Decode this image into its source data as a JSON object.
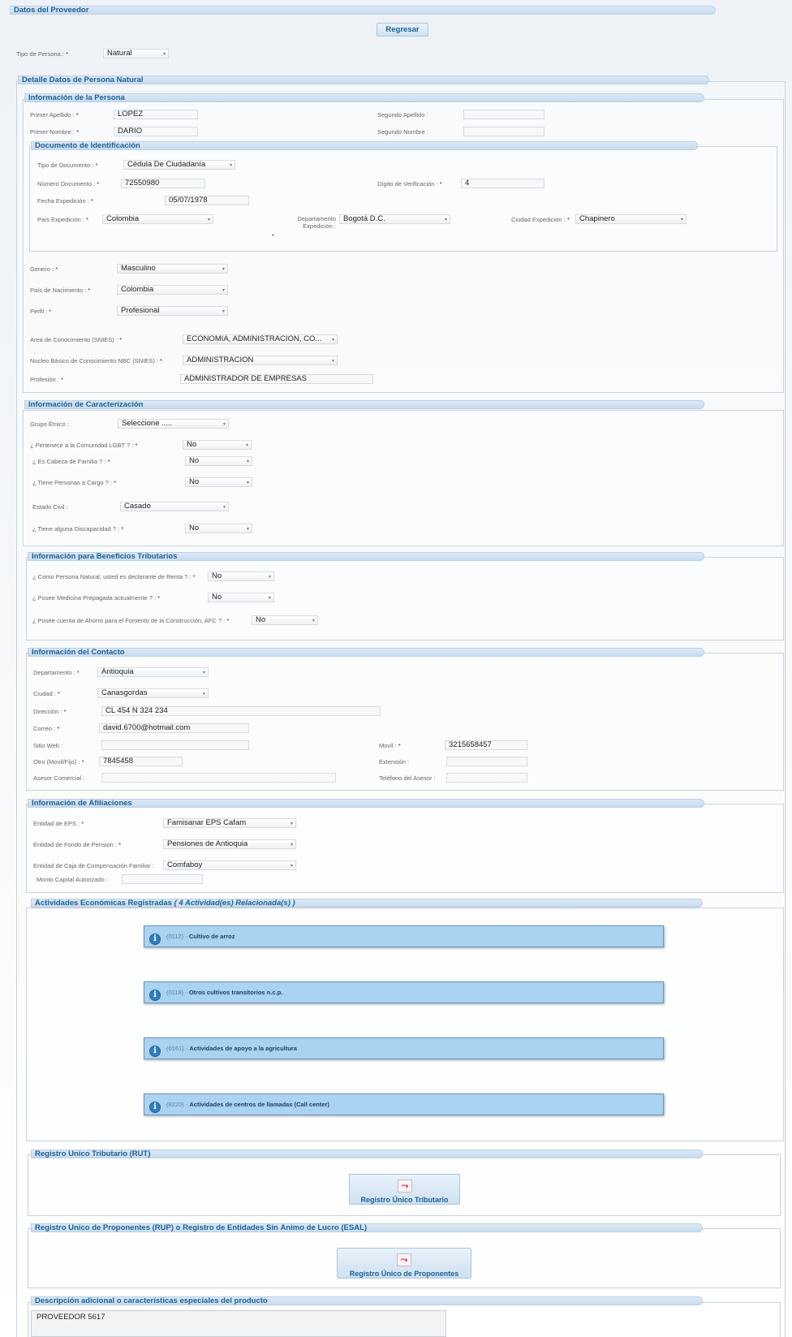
{
  "proveedor": {
    "title": "Datos del Proveedor",
    "regresar": "Regresar",
    "tipo_persona_label": "Tipo de Persona :",
    "tipo_persona_value": "Natural"
  },
  "detalle_title": "Detalle Datos de Persona Natural",
  "persona": {
    "title": "Información de la Persona",
    "primer_apellido_label": "Primer Apellido :",
    "primer_apellido": "LOPEZ",
    "segundo_apellido_label": "Segundo Apellido :",
    "segundo_apellido": "",
    "primer_nombre_label": "Primer Nombre :",
    "primer_nombre": "DARIO",
    "segundo_nombre_label": "Segundo Nombre :",
    "segundo_nombre": ""
  },
  "documento": {
    "title": "Documento de Identificación",
    "tipo_label": "Tipo de Documento :",
    "tipo": "Cédula De Ciudadanía",
    "numero_label": "Número Documento :",
    "numero": "72550980",
    "digito_label": "Dígito de Verificación :",
    "digito": "4",
    "fecha_label": "Fecha Expedición :",
    "fecha": "05/07/1978",
    "pais_label": "País Expedición :",
    "pais": "Colombia",
    "depto_label": "Departamento Expedición :",
    "depto": "Bogotá D.C.",
    "ciudad_label": "Ciudad Expedición :",
    "ciudad": "Chapinero"
  },
  "general": {
    "genero_label": "Genero :",
    "genero": "Masculino",
    "pais_nac_label": "País de Nacimiento :",
    "pais_nac": "Colombia",
    "perfil_label": "Perfil :",
    "perfil": "Profesional",
    "area_label": "Area de Conocimiento (SNIES) :",
    "area": "ECONOMIA, ADMINISTRACION, CO...",
    "nucleo_label": "Nucleo Básico de Conocimiento NBC (SNIES) :",
    "nucleo": "ADMINISTRACION",
    "profesion_label": "Profesión :",
    "profesion": "ADMINISTRADOR DE EMPRESAS"
  },
  "caracterizacion": {
    "title": "Información de Caracterización",
    "etnico_label": "Grupo Étnico :",
    "etnico": "Seleccione .....",
    "lgbt_label": "¿ Pertenece a la Comunidad LGBT ? :",
    "lgbt": "No",
    "cabeza_label": "¿ Es Cabeza de Familia ? :",
    "cabeza": "No",
    "cargo_label": "¿ Tiene Personas a Cargo ? :",
    "cargo": "No",
    "civil_label": "Estado Civil :",
    "civil": "Casado",
    "discap_label": "¿ Tiene alguna Discapacidad ? :",
    "discap": "No"
  },
  "tributarios": {
    "title": "Información para Beneficios Tributarios",
    "renta_label": "¿ Como Persona Natural, usted es declarante de Renta ? :",
    "renta": "No",
    "medicina_label": "¿ Posee Medicina Prepagada actualmente ? :",
    "medicina": "No",
    "afc_label": "¿ Posee cuenta de Ahorro para el Fomento de la Construcción, AFC ? :",
    "afc": "No"
  },
  "contacto": {
    "title": "Información del Contacto",
    "depto_label": "Departamento :",
    "depto": "Antioquia",
    "ciudad_label": "Ciudad :",
    "ciudad": "Canasgordas",
    "direccion_label": "Dirección :",
    "direccion": "CL 454 N 324 234",
    "correo_label": "Correo :",
    "correo": "david.6700@hotmail.com",
    "sitio_label": "Sitio Web :",
    "sitio": "",
    "movil_label": "Movil :",
    "movil": "3215658457",
    "otro_label": "Otro (Movil/Fijo) :",
    "otro": "7845458",
    "extension_label": "Extensión :",
    "extension": "",
    "asesor_label": "Asesor Comercial :",
    "asesor": "",
    "tel_asesor_label": "Teléfono del Asesor :",
    "tel_asesor": ""
  },
  "afiliaciones": {
    "title": "Información de Afiliaciones",
    "eps_label": "Entidad de EPS :",
    "eps": "Famisanar EPS Cafam",
    "pension_label": "Entidad de Fondo de Pension :",
    "pension": "Pensiones de Antioquia",
    "caja_label": "Entidad de Caja de Compensación Familiar :",
    "caja": "Comfaboy",
    "monto_label": "Monto Capital Autorizado :",
    "monto": ""
  },
  "actividades": {
    "title": "Actividades Económicas Registradas",
    "count": "( 4 Actividad(es) Relacionada(s) )",
    "items": [
      {
        "code": "(0112) -",
        "name": "Cultivo de arroz"
      },
      {
        "code": "(0119) -",
        "name": "Otros cultivos transitorios n.c.p."
      },
      {
        "code": "(0161) -",
        "name": "Actividades de apoyo a la agricultura"
      },
      {
        "code": "(8220) -",
        "name": "Actividades de centros de llamadas (Call center)"
      }
    ]
  },
  "rut": {
    "title": "Registro Único Tributario (RUT)",
    "button": "Registro Único Tributario"
  },
  "rup": {
    "title": "Registro Único de Proponentes (RUP) o Registro de Entidades Sin Ánimo de Lucro (ESAL)",
    "button": "Registro Único de Proponentes"
  },
  "descripcion": {
    "title": "Descripción adicional o características especiales del producto",
    "value": "PROVEEDOR 5617"
  },
  "icons": {
    "info": "info-icon",
    "pdf": "pdf-icon",
    "dropdown": "chevron-down-icon"
  }
}
